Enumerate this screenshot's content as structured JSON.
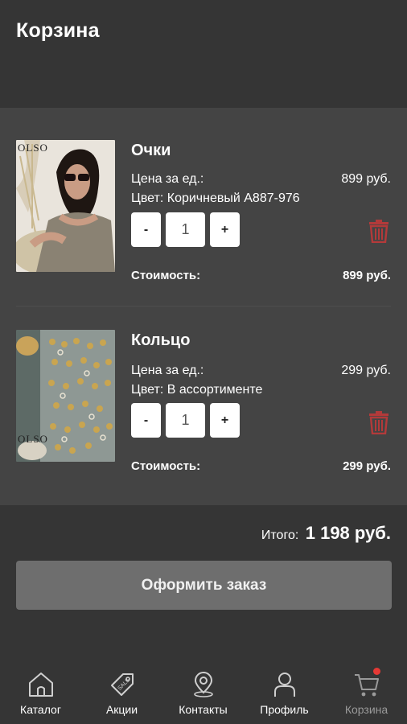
{
  "header": {
    "title": "Корзина"
  },
  "items": [
    {
      "name": "Очки",
      "price_label": "Цена за ед.:",
      "price": "899 руб.",
      "color": "Цвет: Коричневый A887-976",
      "minus": "-",
      "qty": "1",
      "plus": "+",
      "cost_label": "Стоимость:",
      "cost": "899 руб.",
      "image_brand": "OLSO"
    },
    {
      "name": "Кольцо",
      "price_label": "Цена за ед.:",
      "price": "299 руб.",
      "color": "Цвет: В ассортименте",
      "minus": "-",
      "qty": "1",
      "plus": "+",
      "cost_label": "Стоимость:",
      "cost": "299 руб.",
      "image_brand": "OLSO"
    }
  ],
  "summary": {
    "total_label": "Итого:",
    "total_value": "1 198 руб."
  },
  "checkout": {
    "label": "Оформить заказ"
  },
  "tabs": [
    {
      "label": "Каталог",
      "icon": "home-icon"
    },
    {
      "label": "Акции",
      "icon": "sale-tag-icon"
    },
    {
      "label": "Контакты",
      "icon": "location-pin-icon"
    },
    {
      "label": "Профиль",
      "icon": "person-icon"
    },
    {
      "label": "Корзина",
      "icon": "cart-icon",
      "active": true
    }
  ],
  "colors": {
    "background": "#353535",
    "list_background": "#444444",
    "accent_delete": "#b33a3a",
    "checkout_button": "#6e6e6e",
    "badge": "#e53935",
    "inactive_tab_label": "#9a9a9a"
  }
}
